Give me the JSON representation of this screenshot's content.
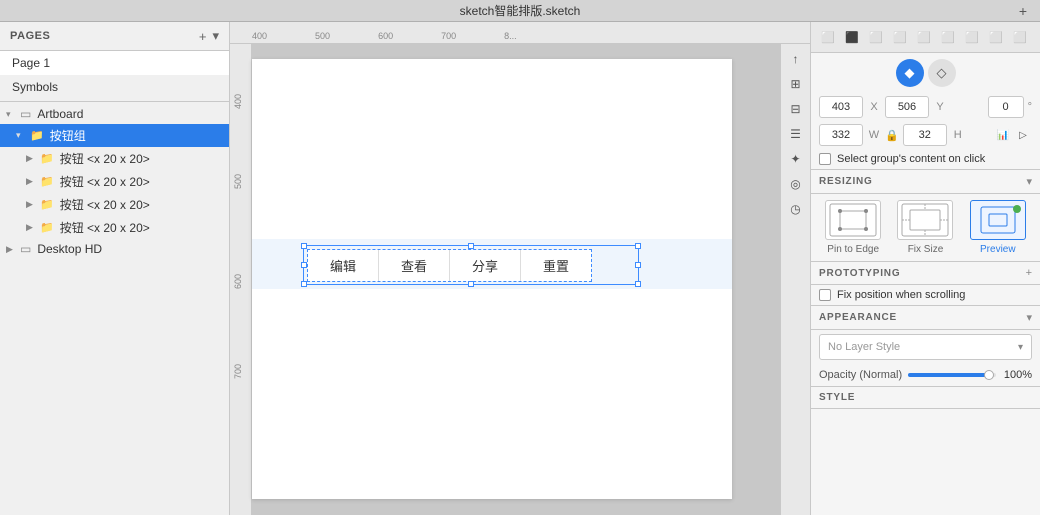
{
  "window": {
    "title": "sketch智能排版.sketch",
    "add_button": "+"
  },
  "left_sidebar": {
    "pages_label": "PAGES",
    "add_page": "+",
    "toggle": "▾",
    "lock_icon": "🔒",
    "pages": [
      {
        "id": "page1",
        "label": "Page 1",
        "active": true
      },
      {
        "id": "symbols",
        "label": "Symbols",
        "active": false
      }
    ],
    "layers": [
      {
        "id": "artboard",
        "label": "Artboard",
        "indent": 0,
        "type": "artboard",
        "chevron": "▾",
        "icon": "▭"
      },
      {
        "id": "button-group",
        "label": "按钮组",
        "indent": 1,
        "type": "group",
        "chevron": "▾",
        "icon": "📁",
        "selected": true
      },
      {
        "id": "btn1",
        "label": "按钮 <x 20 x 20>",
        "indent": 2,
        "type": "group",
        "chevron": "▶",
        "icon": "📁"
      },
      {
        "id": "btn2",
        "label": "按钮 <x 20 x 20>",
        "indent": 2,
        "type": "group",
        "chevron": "▶",
        "icon": "📁"
      },
      {
        "id": "btn3",
        "label": "按钮 <x 20 x 20>",
        "indent": 2,
        "type": "group",
        "chevron": "▶",
        "icon": "📁"
      },
      {
        "id": "btn4",
        "label": "按钮 <x 20 x 20>",
        "indent": 2,
        "type": "group",
        "chevron": "▶",
        "icon": "📁"
      },
      {
        "id": "desktop",
        "label": "Desktop HD",
        "indent": 0,
        "type": "artboard",
        "chevron": "▶",
        "icon": "▭"
      }
    ]
  },
  "right_panel": {
    "toolbar_icons": [
      "⬜",
      "⬜",
      "⬜",
      "⬜",
      "⬜",
      "⬜",
      "⬜",
      "⬜",
      "⬜"
    ],
    "style_tabs": [
      {
        "id": "fill",
        "icon": "◆",
        "active": true
      },
      {
        "id": "border",
        "icon": "◇",
        "active": false
      }
    ],
    "position": {
      "x_label": "X",
      "x_value": "403",
      "y_label": "Y",
      "y_value": "506",
      "angle_label": "°",
      "angle_value": "0"
    },
    "size": {
      "w_label": "W",
      "w_value": "332",
      "h_label": "H",
      "h_value": "32",
      "lock_icon": "🔒"
    },
    "select_group_content": "Select group's content on click",
    "resizing": {
      "title": "RESIZING",
      "cards": [
        {
          "id": "pin-to-edge",
          "label": "Pin to Edge"
        },
        {
          "id": "fix-size",
          "label": "Fix Size"
        },
        {
          "id": "preview",
          "label": "Preview"
        }
      ]
    },
    "prototyping": {
      "title": "PROTOTYPING",
      "add_icon": "+"
    },
    "fix_position": "Fix position when scrolling",
    "appearance": {
      "title": "APPEARANCE",
      "layer_style_placeholder": "No Layer Style"
    },
    "opacity": {
      "label": "Opacity (Normal)",
      "value": "100%",
      "slider_pct": 95
    },
    "style_label": "STYLE"
  },
  "canvas": {
    "ruler_marks_top": [
      "400",
      "500",
      "600",
      "700"
    ],
    "ruler_marks_left": [
      "400",
      "500",
      "600",
      "700"
    ],
    "buttons": [
      {
        "id": "edit",
        "label": "编辑"
      },
      {
        "id": "view",
        "label": "查看"
      },
      {
        "id": "share",
        "label": "分享"
      },
      {
        "id": "reset",
        "label": "重置"
      }
    ]
  },
  "colors": {
    "accent": "#2b7de9",
    "selected_bg": "#2b7de9",
    "selected_text": "#ffffff",
    "canvas_bg": "#c8c8c8",
    "panel_bg": "#f5f5f5",
    "border": "#c8c8c8",
    "green": "#4caf50"
  }
}
